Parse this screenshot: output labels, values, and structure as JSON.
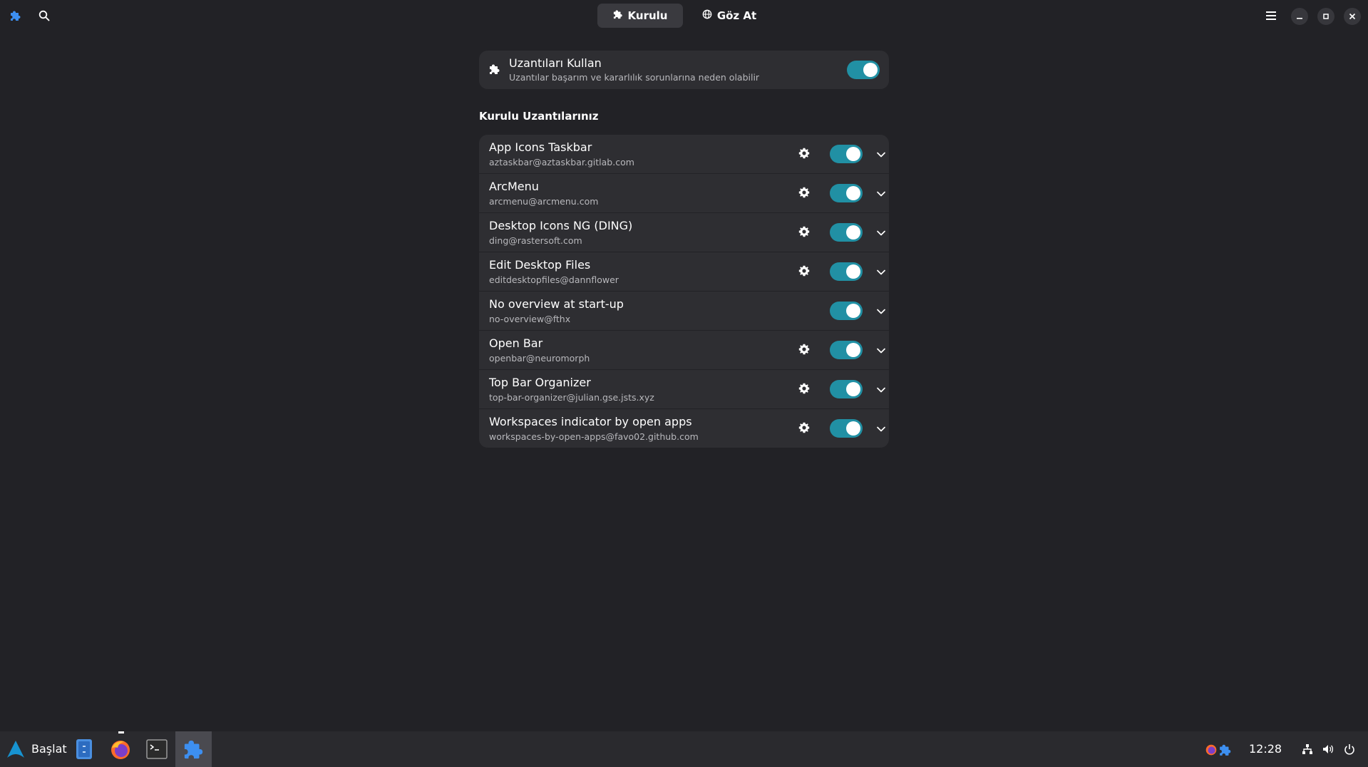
{
  "header": {
    "tabs": [
      {
        "label": "Kurulu",
        "icon": "puzzle-icon",
        "active": true
      },
      {
        "label": "Göz At",
        "icon": "globe-icon",
        "active": false
      }
    ]
  },
  "master": {
    "title": "Uzantıları Kullan",
    "subtitle": "Uzantılar başarım ve kararlılık sorunlarına neden olabilir",
    "enabled": true
  },
  "section": {
    "title": "Kurulu Uzantılarınız"
  },
  "extensions": [
    {
      "name": "App Icons Taskbar",
      "uuid": "aztaskbar@aztaskbar.gitlab.com",
      "has_settings": true,
      "enabled": true
    },
    {
      "name": "ArcMenu",
      "uuid": "arcmenu@arcmenu.com",
      "has_settings": true,
      "enabled": true
    },
    {
      "name": "Desktop Icons NG (DING)",
      "uuid": "ding@rastersoft.com",
      "has_settings": true,
      "enabled": true
    },
    {
      "name": "Edit Desktop Files",
      "uuid": "editdesktopfiles@dannflower",
      "has_settings": true,
      "enabled": true
    },
    {
      "name": "No overview at start-up",
      "uuid": "no-overview@fthx",
      "has_settings": false,
      "enabled": true
    },
    {
      "name": "Open Bar",
      "uuid": "openbar@neuromorph",
      "has_settings": true,
      "enabled": true
    },
    {
      "name": "Top Bar Organizer",
      "uuid": "top-bar-organizer@julian.gse.jsts.xyz",
      "has_settings": true,
      "enabled": true
    },
    {
      "name": "Workspaces indicator by open apps",
      "uuid": "workspaces-by-open-apps@favo02.github.com",
      "has_settings": true,
      "enabled": true
    }
  ],
  "taskbar": {
    "start_label": "Başlat",
    "clock": "12:28"
  },
  "colors": {
    "accent": "#2190a4",
    "background": "#222226",
    "card": "#2e2e32",
    "taskbar": "#2a2a2e"
  }
}
